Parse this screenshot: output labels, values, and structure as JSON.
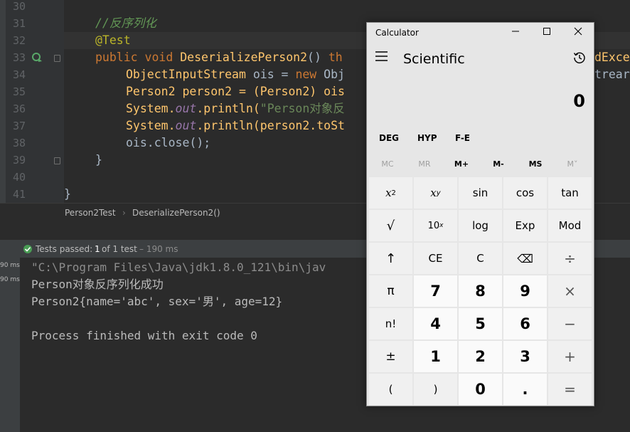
{
  "editor": {
    "line_numbers": [
      "30",
      "31",
      "32",
      "33",
      "34",
      "35",
      "36",
      "37",
      "38",
      "39",
      "40",
      "41"
    ],
    "lines": {
      "l31_comment": "//反序列化",
      "l32_annotation": "@Test",
      "l33_public": "public",
      "l33_void": "void",
      "l33_method": "DeserializePerson2",
      "l33_parens": "() ",
      "l33_th": "th",
      "l33_tail": "dExce",
      "l34_type": "ObjectInputStream",
      "l34_var": " ois = ",
      "l34_new": "new",
      "l34_obj": " Obj",
      "l34_tail": "trear",
      "l35_a": "Person2 person2 = (Person2) ois",
      "l36_sys": "System.",
      "l36_out": "out",
      "l36_println": ".println(",
      "l36_str": "\"Person对象反",
      "l37_sys": "System.",
      "l37_out": "out",
      "l37_rest": ".println(person2.toSt",
      "l38": "ois.close();",
      "l39": "}",
      "l41": "}"
    }
  },
  "breadcrumb": {
    "class_name": "Person2Test",
    "separator": "›",
    "method_name": "DeserializePerson2()"
  },
  "run_panel": {
    "status_label": "Tests passed:",
    "passed_count": "1",
    "of_text": "of 1 test",
    "duration": "– 190 ms",
    "side_times": [
      "90 ms",
      "90 ms"
    ]
  },
  "console": {
    "lines": [
      "\"C:\\Program Files\\Java\\jdk1.8.0_121\\bin\\jav",
      "Person对象反序列化成功",
      "Person2{name='abc', sex='男', age=12}",
      "",
      "Process finished with exit code 0"
    ]
  },
  "calculator": {
    "window_title": "Calculator",
    "mode": "Scientific",
    "display_value": "0",
    "trig": [
      "DEG",
      "HYP",
      "F-E"
    ],
    "memory": [
      {
        "label": "MC",
        "enabled": false
      },
      {
        "label": "MR",
        "enabled": false
      },
      {
        "label": "M+",
        "enabled": true
      },
      {
        "label": "M-",
        "enabled": true
      },
      {
        "label": "MS",
        "enabled": true
      },
      {
        "label": "M˅",
        "enabled": false
      }
    ],
    "keys": {
      "x2_base": "x",
      "x2_exp": "2",
      "xy_base": "x",
      "xy_exp": "y",
      "sin": "sin",
      "cos": "cos",
      "tan": "tan",
      "sqrt": "√",
      "tenx_base": "10",
      "tenx_exp": "x",
      "log": "log",
      "exp": "Exp",
      "mod": "Mod",
      "up": "↑",
      "ce": "CE",
      "c": "C",
      "backspace": "⌫",
      "divide": "÷",
      "pi": "π",
      "n7": "7",
      "n8": "8",
      "n9": "9",
      "multiply": "×",
      "fact": "n!",
      "n4": "4",
      "n5": "5",
      "n6": "6",
      "minus": "−",
      "negate": "±",
      "n1": "1",
      "n2": "2",
      "n3": "3",
      "plus": "+",
      "lparen": "(",
      "rparen": ")",
      "n0": "0",
      "dot": ".",
      "equals": "="
    }
  }
}
